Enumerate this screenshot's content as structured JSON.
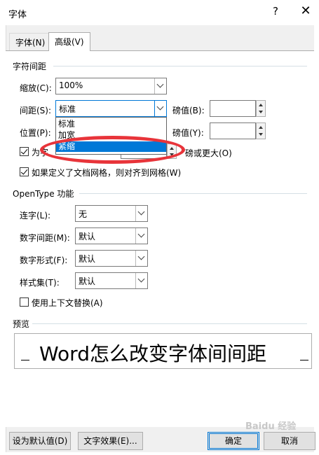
{
  "window": {
    "title": "字体",
    "help_label": "?",
    "close_label": "✕"
  },
  "tabs": [
    {
      "label": "字体(N)",
      "active": false
    },
    {
      "label": "高级(V)",
      "active": true
    }
  ],
  "char_spacing": {
    "section_title": "字符间距",
    "scale_label": "缩放(C):",
    "scale_value": "100%",
    "spacing_label": "间距(S):",
    "spacing_value": "标准",
    "spacing_by_label": "磅值(B):",
    "spacing_by_value": "",
    "position_label": "位置(P):",
    "position_by_label": "磅值(Y):",
    "position_by_value": "",
    "kerning_label_prefix": "为字",
    "kerning_label_suffix": "磅或更大(O)",
    "kerning_checked": true,
    "grid_label": "如果定义了文档网格，则对齐到网格(W)",
    "grid_checked": true,
    "spacing_options": [
      "标准",
      "加宽",
      "紧缩"
    ],
    "spacing_highlighted": "紧缩"
  },
  "opentype": {
    "section_title": "OpenType 功能",
    "ligatures_label": "连字(L):",
    "ligatures_value": "无",
    "num_spacing_label": "数字间距(M):",
    "num_spacing_value": "默认",
    "num_forms_label": "数字形式(F):",
    "num_forms_value": "默认",
    "stylistic_label": "样式集(T):",
    "stylistic_value": "默认",
    "contextual_label": "使用上下文替换(A)",
    "contextual_checked": false
  },
  "preview": {
    "section_title": "预览",
    "text": "Word怎么改变字体间间距"
  },
  "footer": {
    "default_button": "设为默认值(D)",
    "effects_button": "文字效果(E)...",
    "ok_button": "确定",
    "cancel_button": "取消"
  },
  "watermark": "Baidu 经验",
  "colors": {
    "accent": "#0078d7",
    "highlight_oval": "#e8343a"
  }
}
